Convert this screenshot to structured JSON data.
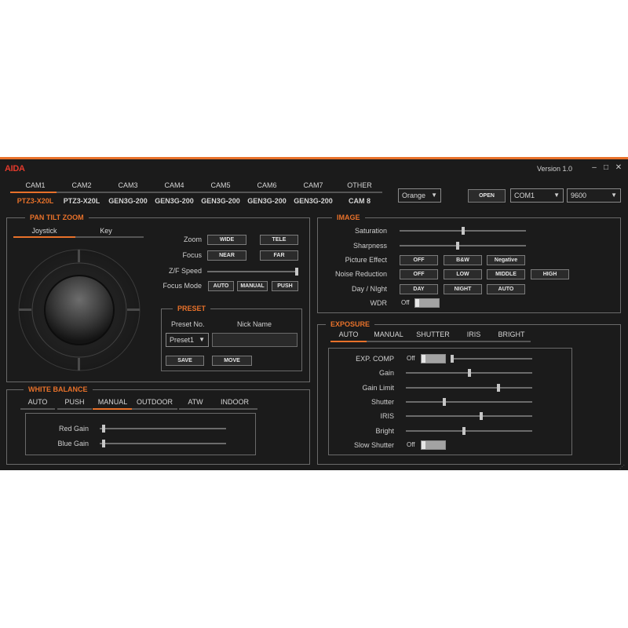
{
  "app": {
    "brand": "AIDA",
    "version": "Version 1.0"
  },
  "window_controls": {
    "minimize": "–",
    "maximize": "□",
    "close": "✕"
  },
  "cameras": [
    {
      "tab": "CAM1",
      "model": "PTZ3-X20L",
      "active": true
    },
    {
      "tab": "CAM2",
      "model": "PTZ3-X20L",
      "active": false
    },
    {
      "tab": "CAM3",
      "model": "GEN3G-200",
      "active": false
    },
    {
      "tab": "CAM4",
      "model": "GEN3G-200",
      "active": false
    },
    {
      "tab": "CAM5",
      "model": "GEN3G-200",
      "active": false
    },
    {
      "tab": "CAM6",
      "model": "GEN3G-200",
      "active": false
    },
    {
      "tab": "CAM7",
      "model": "GEN3G-200",
      "active": false
    },
    {
      "tab": "OTHER",
      "model": "CAM 8",
      "active": false
    }
  ],
  "connection": {
    "color": "Orange",
    "open": "OPEN",
    "port": "COM1",
    "baud": "9600"
  },
  "ptz": {
    "title": "PAN TILT ZOOM",
    "tabs": [
      "Joystick",
      "Key"
    ],
    "zoom": {
      "label": "Zoom",
      "wide": "WIDE",
      "tele": "TELE"
    },
    "focus": {
      "label": "Focus",
      "near": "NEAR",
      "far": "FAR"
    },
    "zf_speed": {
      "label": "Z/F Speed",
      "value": 1.0
    },
    "focus_mode": {
      "label": "Focus Mode",
      "auto": "AUTO",
      "manual": "MANUAL",
      "push": "PUSH"
    }
  },
  "preset": {
    "title": "PRESET",
    "no_label": "Preset No.",
    "nick_label": "Nick Name",
    "selected": "Preset1",
    "nick_value": "",
    "save": "SAVE",
    "move": "MOVE"
  },
  "white_balance": {
    "title": "WHITE BALANCE",
    "tabs": [
      "AUTO",
      "PUSH",
      "MANUAL",
      "OUTDOOR",
      "ATW",
      "INDOOR"
    ],
    "active_tab": "MANUAL",
    "red_gain": {
      "label": "Red Gain",
      "value": 0.02
    },
    "blue_gain": {
      "label": "Blue Gain",
      "value": 0.02
    }
  },
  "image": {
    "title": "IMAGE",
    "saturation": {
      "label": "Saturation",
      "value": 0.5
    },
    "sharpness": {
      "label": "Sharpness",
      "value": 0.46
    },
    "picture_effect": {
      "label": "Picture Effect",
      "off": "OFF",
      "bw": "B&W",
      "negative": "Negative"
    },
    "noise_reduction": {
      "label": "Noise Reduction",
      "off": "OFF",
      "low": "LOW",
      "middle": "MIDDLE",
      "high": "HIGH"
    },
    "day_night": {
      "label": "Day / NIght",
      "day": "DAY",
      "night": "NIGHT",
      "auto": "AUTO"
    },
    "wdr": {
      "label": "WDR",
      "state": "Off"
    }
  },
  "exposure": {
    "title": "EXPOSURE",
    "tabs": [
      "AUTO",
      "MANUAL",
      "SHUTTER",
      "IRIS",
      "BRIGHT"
    ],
    "active_tab": "AUTO",
    "exp_comp": {
      "label": "EXP. COMP",
      "state": "Off",
      "value": 0.0
    },
    "gain": {
      "label": "Gain",
      "value": 0.5
    },
    "gain_limit": {
      "label": "Gain Limit",
      "value": 0.74
    },
    "shutter": {
      "label": "Shutter",
      "value": 0.3
    },
    "iris": {
      "label": "IRIS",
      "value": 0.6
    },
    "bright": {
      "label": "Bright",
      "value": 0.46
    },
    "slow_shutter": {
      "label": "Slow Shutter",
      "state": "Off"
    }
  }
}
